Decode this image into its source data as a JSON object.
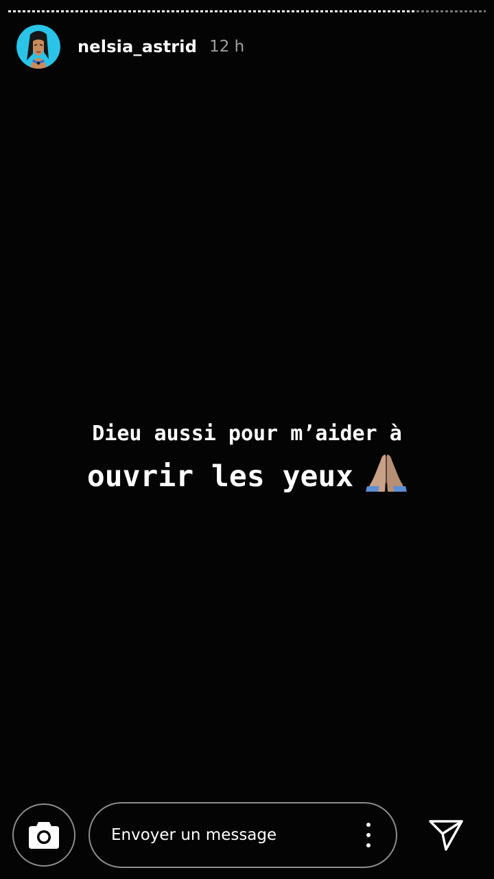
{
  "story": {
    "progress": [
      1.0,
      0.7
    ],
    "user": {
      "username": "nelsia_astrid",
      "time_ago": "12 h",
      "avatar_icon": "profile-avatar-illustration"
    },
    "caption": {
      "line1": "Dieu aussi pour m’aider à",
      "line2": "ouvrir les yeux",
      "emoji": "folded-hands-emoji"
    }
  },
  "reply_bar": {
    "camera_icon": "camera-icon",
    "placeholder": "Envoyer un message",
    "more_icon": "more-vertical-icon",
    "send_icon": "send-icon"
  },
  "colors": {
    "background": "#040404",
    "text": "#ffffff",
    "avatar_bg": "#29c4e8"
  }
}
